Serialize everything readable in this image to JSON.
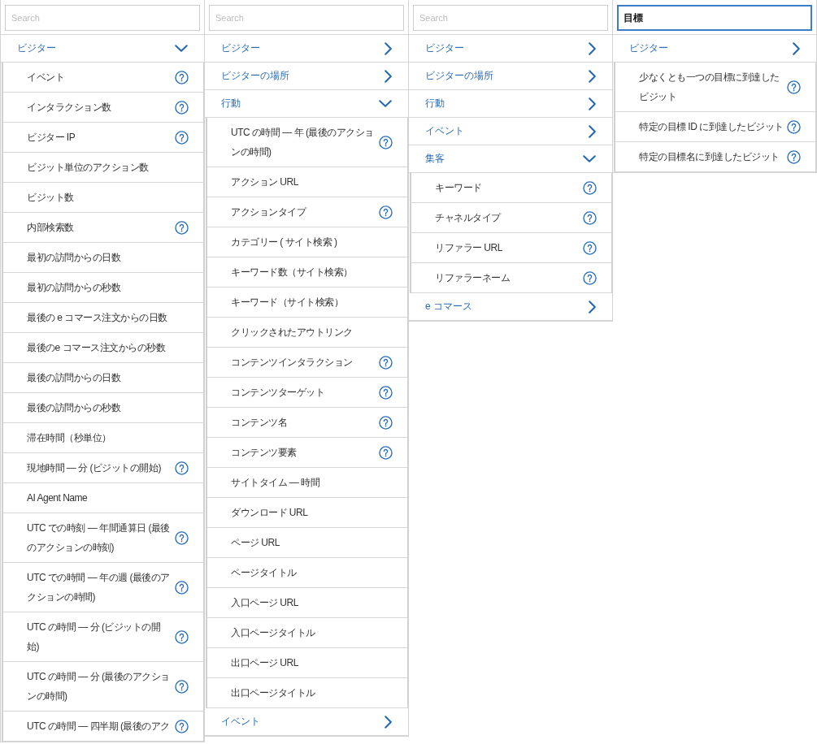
{
  "panels": [
    {
      "search": {
        "placeholder": "Search",
        "focused": false
      },
      "categories": [
        {
          "label": "ビジター",
          "expanded": true,
          "items": [
            {
              "label": "イベント",
              "help": true
            },
            {
              "label": "インタラクション数",
              "help": true
            },
            {
              "label": "ビジター IP",
              "help": true
            },
            {
              "label": "ビジット単位のアクション数",
              "help": false
            },
            {
              "label": "ビジット数",
              "help": false
            },
            {
              "label": "内部検索数",
              "help": true
            },
            {
              "label": "最初の訪問からの日数",
              "help": false
            },
            {
              "label": "最初の訪問からの秒数",
              "help": false
            },
            {
              "label": "最後の e コマース注文からの日数",
              "help": false
            },
            {
              "label": "最後のe コマース注文からの秒数",
              "help": false
            },
            {
              "label": "最後の訪問からの日数",
              "help": false
            },
            {
              "label": "最後の訪問からの秒数",
              "help": false
            },
            {
              "label": "滞在時間（秒単位）",
              "help": false
            },
            {
              "label": "現地時間 — 分 (ビジットの開始)",
              "help": true
            },
            {
              "label": "AI Agent Name",
              "help": false
            },
            {
              "label": "UTC での時刻 — 年間通算日 (最後のアクションの時刻)",
              "help": true
            },
            {
              "label": "UTC での時間 — 年の週 (最後のアクションの時間)",
              "help": true
            },
            {
              "label": "UTC の時間 — 分 (ビジットの開始)",
              "help": true
            },
            {
              "label": "UTC の時間 — 分 (最後のアクションの時間)",
              "help": true
            },
            {
              "label": "UTC の時間 — 四半期 (最後のアク",
              "help": true
            }
          ]
        }
      ]
    },
    {
      "search": {
        "placeholder": "Search",
        "focused": false
      },
      "categories": [
        {
          "label": "ビジター",
          "expanded": false
        },
        {
          "label": "ビジターの場所",
          "expanded": false
        },
        {
          "label": "行動",
          "expanded": true,
          "items": [
            {
              "label": "UTC の時間 — 年 (最後のアクションの時間)",
              "help": true
            },
            {
              "label": "アクション URL",
              "help": false
            },
            {
              "label": "アクションタイプ",
              "help": true
            },
            {
              "label": "カテゴリー ( サイト検索 )",
              "help": false
            },
            {
              "label": "キーワード数（サイト検索）",
              "help": false
            },
            {
              "label": "キーワード（サイト検索）",
              "help": false
            },
            {
              "label": "クリックされたアウトリンク",
              "help": false
            },
            {
              "label": "コンテンツインタラクション",
              "help": true
            },
            {
              "label": "コンテンツターゲット",
              "help": true
            },
            {
              "label": "コンテンツ名",
              "help": true
            },
            {
              "label": "コンテンツ要素",
              "help": true
            },
            {
              "label": "サイトタイム — 時間",
              "help": false
            },
            {
              "label": "ダウンロード URL",
              "help": false
            },
            {
              "label": "ページ URL",
              "help": false
            },
            {
              "label": "ページタイトル",
              "help": false
            },
            {
              "label": "入口ページ URL",
              "help": false
            },
            {
              "label": "入口ページタイトル",
              "help": false
            },
            {
              "label": "出口ページ URL",
              "help": false
            },
            {
              "label": "出口ページタイトル",
              "help": false
            }
          ]
        },
        {
          "label": "イベント",
          "expanded": false
        }
      ]
    },
    {
      "search": {
        "placeholder": "Search",
        "focused": false
      },
      "categories": [
        {
          "label": "ビジター",
          "expanded": false
        },
        {
          "label": "ビジターの場所",
          "expanded": false
        },
        {
          "label": "行動",
          "expanded": false
        },
        {
          "label": "イベント",
          "expanded": false
        },
        {
          "label": "集客",
          "expanded": true,
          "items": [
            {
              "label": "キーワード",
              "help": true
            },
            {
              "label": "チャネルタイプ",
              "help": true
            },
            {
              "label": "リファラー URL",
              "help": true
            },
            {
              "label": "リファラーネーム",
              "help": true
            }
          ]
        },
        {
          "label": "e コマース",
          "expanded": false
        }
      ]
    },
    {
      "search": {
        "value": "目標",
        "focused": true
      },
      "categories": [
        {
          "label": "ビジター",
          "expanded": false,
          "items": [
            {
              "label": "少なくとも一つの目標に到達したビジット",
              "help": true
            },
            {
              "label": "特定の目標 ID に到達したビジット",
              "help": true
            },
            {
              "label": "特定の目標名に到達したビジット",
              "help": true
            }
          ]
        }
      ]
    }
  ]
}
